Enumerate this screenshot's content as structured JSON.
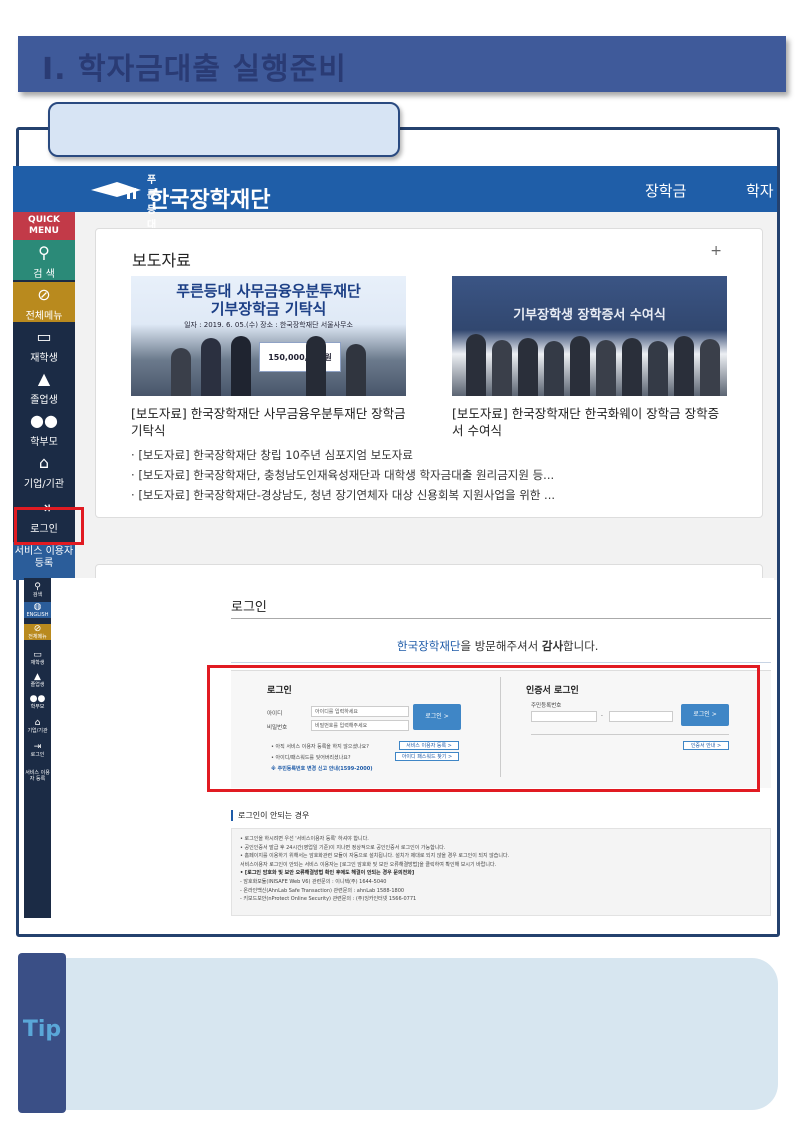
{
  "header": {
    "title": "Ⅰ. 학자금대출 실행준비",
    "tab_label": ""
  },
  "site1": {
    "logo_small": "푸른등대",
    "logo_name": "한국장학재단",
    "nav": [
      "장학금",
      "학자"
    ],
    "quick_menu": {
      "head": "QUICK MENU",
      "items": [
        {
          "label": "검 색",
          "icon": "search-icon"
        },
        {
          "label": "전체메뉴",
          "icon": "compass-icon"
        },
        {
          "label": "재학생",
          "icon": "book-icon"
        },
        {
          "label": "졸업생",
          "icon": "graduation-cap-icon"
        },
        {
          "label": "학부모",
          "icon": "people-icon"
        },
        {
          "label": "기업/기관",
          "icon": "building-icon"
        },
        {
          "label": "로그인",
          "icon": "login-icon"
        },
        {
          "label": "서비스 이용자 등록",
          "icon": ""
        }
      ]
    },
    "press": {
      "title": "보도자료",
      "plus": "+",
      "photo1_title": "푸른등대 사무금융우분투재단",
      "photo1_sub": "기부장학금 기탁식",
      "photo1_date": "일자 : 2019. 6. 05.(수)    장소 : 한국장학재단 서울사무소",
      "photo1_check": "150,000,000원",
      "photo2_title": "기부장학생 장학증서 수여식",
      "caption1": "[보도자료] 한국장학재단 사무금융우분투재단 장학금 기탁식",
      "caption2": "[보도자료] 한국장학재단 한국화웨이 장학금 장학증서 수여식",
      "bullets": [
        "[보도자료] 한국장학재단 창립 10주년 심포지엄 보도자료",
        "[보도자료] 한국장학재단, 충청남도인재육성재단과 대학생 학자금대출 원리금지원 등...",
        "[보도자료] 한국장학재단-경상남도, 청년 장기연체자 대상 신용회복 지원사업을 위한 ..."
      ]
    }
  },
  "site2": {
    "side_items": [
      {
        "label": "검색",
        "icon": "search-icon"
      },
      {
        "label": "ENGLISH",
        "icon": "globe-icon"
      },
      {
        "label": "전체메뉴",
        "icon": "compass-icon"
      },
      {
        "label": "재학생",
        "icon": "book-icon"
      },
      {
        "label": "졸업생",
        "icon": "graduation-cap-icon"
      },
      {
        "label": "학부모",
        "icon": "people-icon"
      },
      {
        "label": "기업/기관",
        "icon": "building-icon"
      },
      {
        "label": "로그인",
        "icon": "login-icon"
      },
      {
        "label": "서비스 이용자 등록",
        "icon": ""
      }
    ],
    "login_title": "로그인",
    "welcome_org": "한국장학재단",
    "welcome_mid": "을 방문해주셔서 ",
    "welcome_bold": "감사",
    "welcome_end": "합니다.",
    "id_login": {
      "title": "로그인",
      "id_label": "아이디",
      "pw_label": "비밀번호",
      "id_placeholder": "아이디를 입력하세요",
      "pw_placeholder": "비밀번호를 입력해주세요",
      "button": "로그인 >",
      "q1": "• 아직 서비스 이용자 등록을 하지 않으셨나요?",
      "q1_button": "서비스 이용자 등록 >",
      "q2": "• 아이디/패스워드를 잊어버리셨나요?",
      "q2_button": "아이디 패스워드 찾기 >",
      "notice": "※ 주민등록번호 변경 신고 안내(1599-2000)"
    },
    "cert_login": {
      "title": "인증서 로그인",
      "rrn_label": "주민등록번호",
      "dash": "-",
      "button": "로그인 >",
      "guide_button": "인증서 안내 >"
    },
    "fail": {
      "title": "로그인이 안되는 경우",
      "lines": [
        "• 로그인을 하시려면 우선 '서비스이용자 등록' 하셔야 합니다.",
        "• 공인인증서 발급 후 24시간(영업일 기준)이 지나면 정상적으로 공인인증서 로그인이 가능합니다.",
        "• 홈페이지를 이용하기 위해서는 암호화관련 모듈이 자동으로 설치됩니다. 설치가 제대로 되지 않을 경우 로그인이 되지 않습니다.",
        "   서비스이용자 로그인이 안되는 서비스 이용자는 [로그인 암호화 및 보안 오류해결방법]을 클릭하여 확인해 보시기 바랍니다.",
        "• [로그인 암호화 및 보안 오류해결방법 확인 후에도 해결이 안되는 경우 문의전화]",
        "  - 암호화모듈(INISAFE Web V6) 관련문의 : 이니텍(주) 1644-5040",
        "  - 온라인백신(AhnLab Safe Transaction) 관련문의 : ahnLab 1588-1800",
        "  - 키보드보안(nProtect Online Security) 관련문의 : (주)잉카인터넷 1566-0771"
      ]
    }
  },
  "tip": {
    "label": "Tip",
    "text": ""
  }
}
